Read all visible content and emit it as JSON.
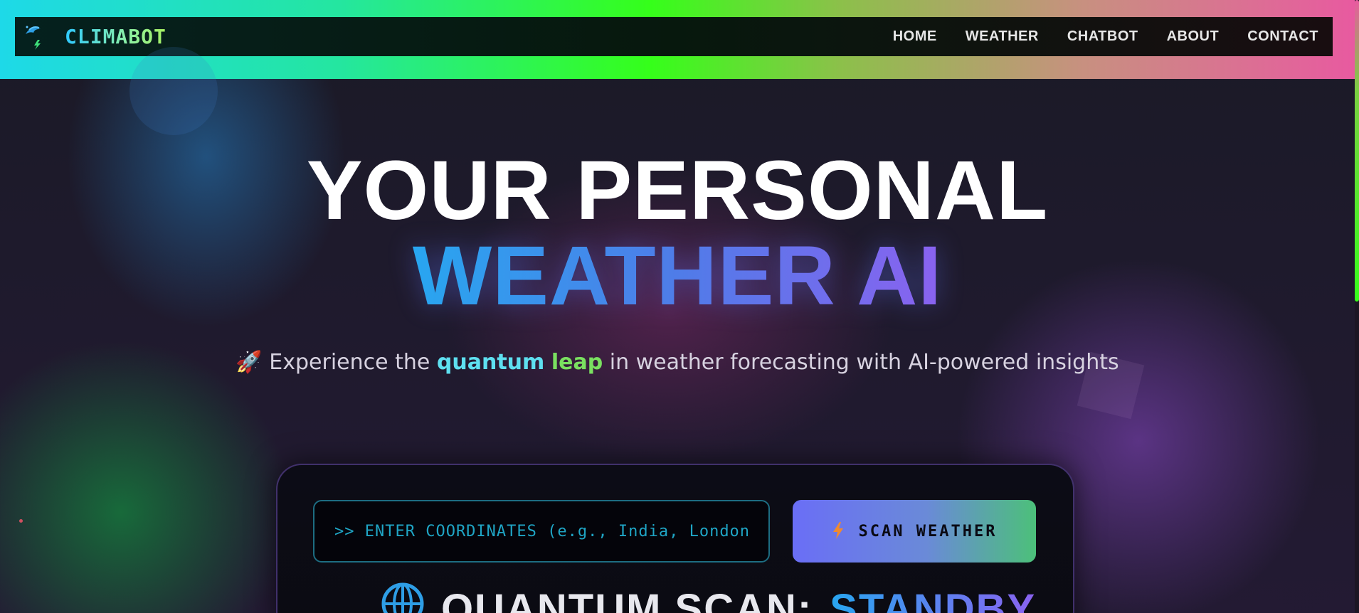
{
  "brand": {
    "name": "CLIMABOT",
    "logo_icon": "umbrella-lightning-icon"
  },
  "nav": {
    "items": [
      {
        "label": "HOME"
      },
      {
        "label": "WEATHER"
      },
      {
        "label": "CHATBOT"
      },
      {
        "label": "ABOUT"
      },
      {
        "label": "CONTACT"
      }
    ]
  },
  "hero": {
    "title_line1": "YOUR PERSONAL",
    "title_line2": "WEATHER AI",
    "subtitle_emoji": "🚀",
    "subtitle_pre": "Experience the ",
    "subtitle_hl1": "quantum",
    "subtitle_hl2": "leap",
    "subtitle_post": " in weather forecasting with AI-powered insights"
  },
  "search": {
    "placeholder": ">> ENTER COORDINATES (e.g., India, London",
    "value": "",
    "button_label": "SCAN WEATHER",
    "button_icon": "lightning-icon"
  },
  "status": {
    "icon": "globe-icon",
    "label": "QUANTUM SCAN:",
    "state": "STANDBY"
  },
  "colors": {
    "accent_cyan": "#1fa5c5",
    "accent_green": "#35ff1a",
    "accent_purple": "#8a62f0",
    "accent_blue": "#28a6f0"
  }
}
